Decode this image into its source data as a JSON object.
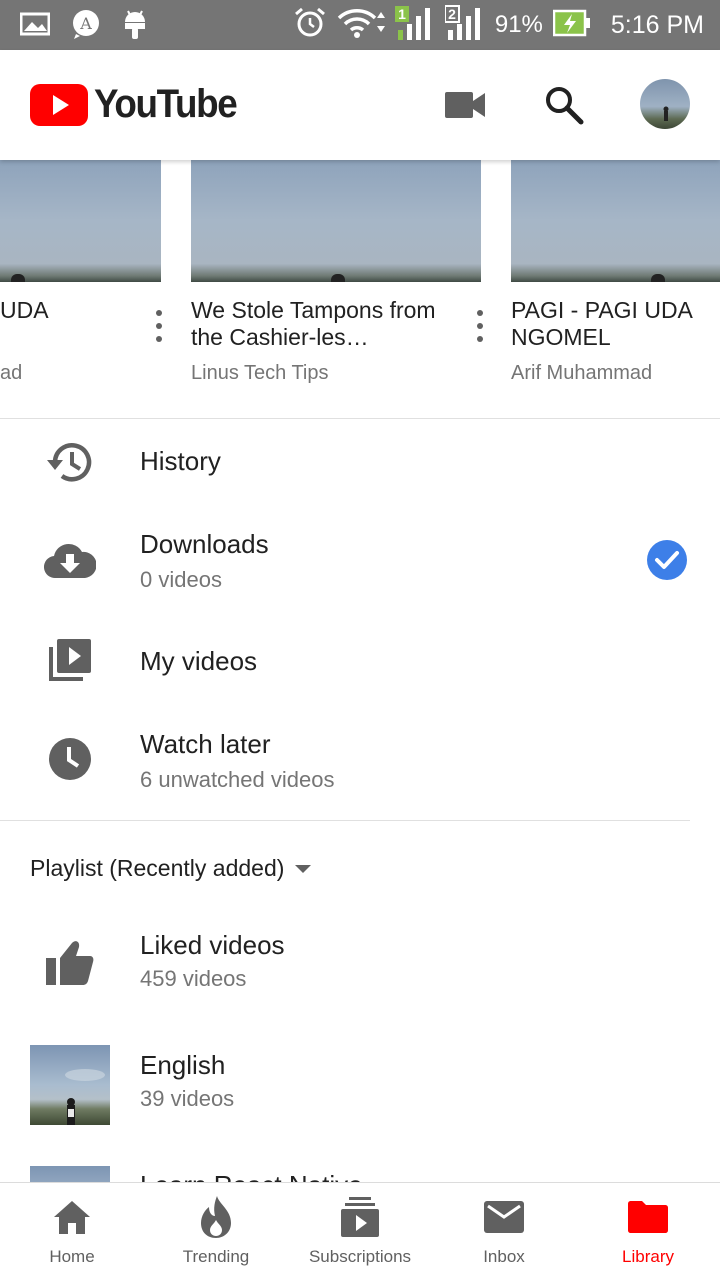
{
  "status_bar": {
    "battery": "91%",
    "time": "5:16 PM",
    "sim1": "1",
    "sim2": "2"
  },
  "app_bar": {
    "logo_text": "YouTube",
    "brand_color": "#ff0000",
    "icons": [
      "video-camera-icon",
      "search-icon",
      "account-avatar"
    ]
  },
  "recent": [
    {
      "title": "UDA",
      "subtitle": "ad"
    },
    {
      "title": "We Stole Tampons from the Cashier-les…",
      "subtitle": "Linus Tech Tips"
    },
    {
      "title": "PAGI - PAGI UDA NGOMEL",
      "subtitle": "Arif Muhammad"
    }
  ],
  "library": {
    "history": {
      "title": "History"
    },
    "downloads": {
      "title": "Downloads",
      "subtitle": "0 videos"
    },
    "my_videos": {
      "title": "My videos"
    },
    "watch_later": {
      "title": "Watch later",
      "subtitle": "6 unwatched videos"
    }
  },
  "playlists": {
    "header": "Playlist (Recently added)",
    "items": [
      {
        "title": "Liked videos",
        "subtitle": "459 videos"
      },
      {
        "title": "English",
        "subtitle": "39 videos"
      },
      {
        "title": "Learn React Native",
        "subtitle": ""
      }
    ]
  },
  "bottom_nav": {
    "items": [
      {
        "label": "Home",
        "icon": "home-icon"
      },
      {
        "label": "Trending",
        "icon": "flame-icon"
      },
      {
        "label": "Subscriptions",
        "icon": "subscriptions-icon"
      },
      {
        "label": "Inbox",
        "icon": "mail-icon"
      },
      {
        "label": "Library",
        "icon": "folder-icon"
      }
    ],
    "active": "Library",
    "active_color": "#ff0000",
    "inactive_color": "#606060"
  }
}
